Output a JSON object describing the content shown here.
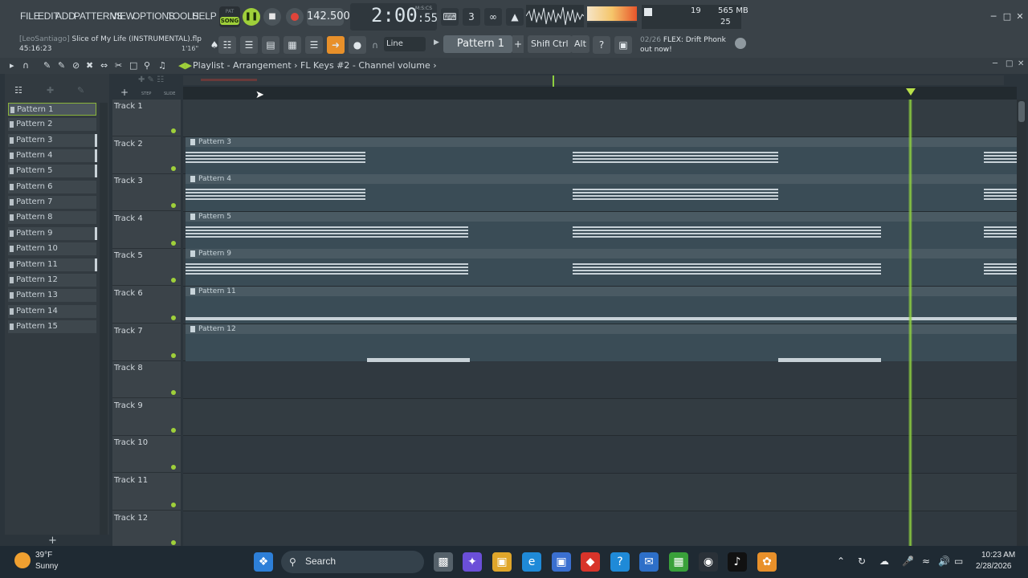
{
  "menu": [
    "FILE",
    "EDIT",
    "ADD",
    "PATTERNS",
    "VIEW",
    "OPTIONS",
    "TOOLS",
    "HELP"
  ],
  "transport": {
    "pat_label": "PAT",
    "song_label": "SONG",
    "tempo": "142.500",
    "time": "2:00",
    "time_sub": ":55",
    "time_units": "M:S:CS"
  },
  "cpu": {
    "cpu": "19",
    "memory": "565 MB",
    "polyphony": "25"
  },
  "project": {
    "user": "[LeoSantiago]",
    "name": "Slice of My Life (INSTRUMENTAL).flp",
    "elapsed": "45:16:23",
    "length": "1'16\""
  },
  "toolbar2": {
    "snap": "Line",
    "pattern": "Pattern 1",
    "shift": "Shift",
    "ctrl": "Ctrl",
    "alt": "Alt"
  },
  "news": {
    "date": "02/26",
    "text": "FLEX: Drift Phonk out now!"
  },
  "playlist": {
    "path": "Playlist - Arrangement › FL Keys #2 - Channel volume ›",
    "step_label": "STEP",
    "slide_label": "SLIDE"
  },
  "picker": [
    "Pattern 1",
    "Pattern 2",
    "Pattern 3",
    "Pattern 4",
    "Pattern 5",
    "Pattern 6",
    "Pattern 7",
    "Pattern 8",
    "Pattern 9",
    "Pattern 10",
    "Pattern 11",
    "Pattern 12",
    "Pattern 13",
    "Pattern 14",
    "Pattern 15"
  ],
  "tracks": [
    "Track 1",
    "Track 2",
    "Track 3",
    "Track 4",
    "Track 5",
    "Track 6",
    "Track 7",
    "Track 8",
    "Track 9",
    "Track 10",
    "Track 11",
    "Track 12"
  ],
  "clips": [
    "Pattern 3",
    "Pattern 4",
    "Pattern 5",
    "Pattern 9",
    "Pattern 11",
    "Pattern 12"
  ],
  "taskbar": {
    "temp": "39°F",
    "weather": "Sunny",
    "search": "Search",
    "time": "10:23 AM",
    "date": "2/28/2026"
  }
}
